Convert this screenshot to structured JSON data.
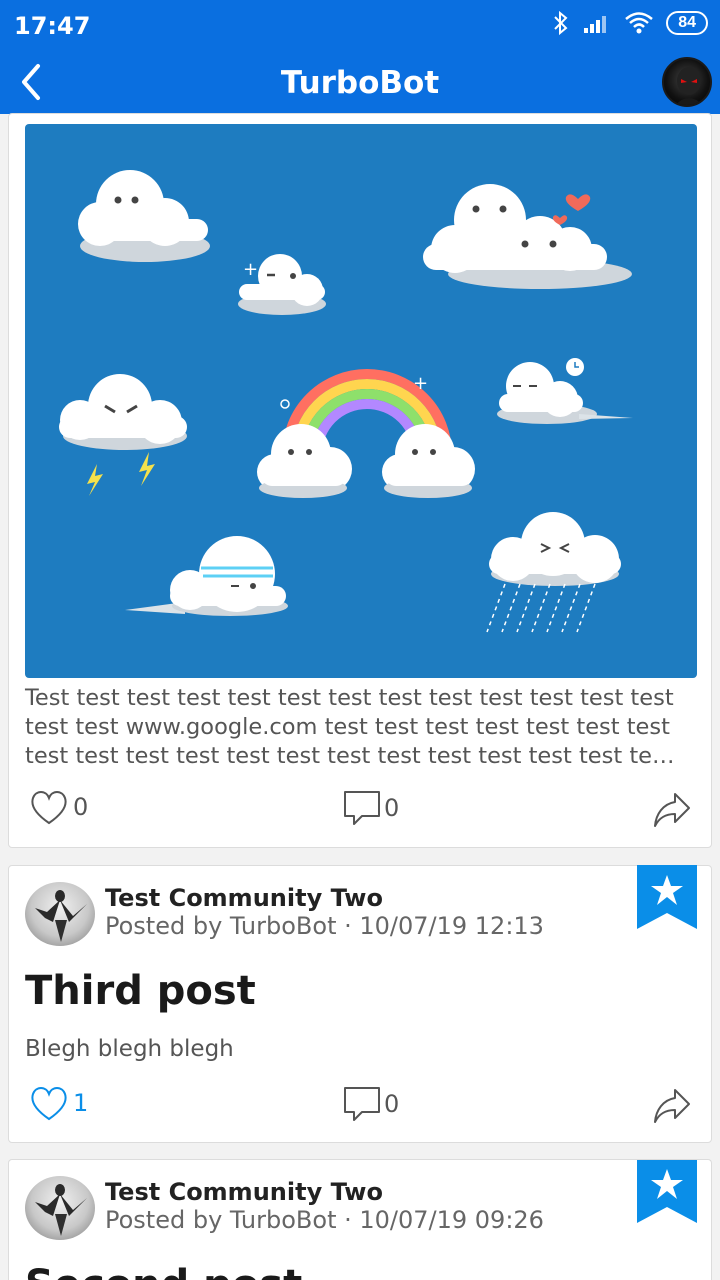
{
  "status": {
    "time": "17:47",
    "battery": "84"
  },
  "appbar": {
    "title": "TurboBot"
  },
  "posts": [
    {
      "text": "Test test test test test test test test test test test test test test test www.google.com test test test test test test test test test test test test test test test test test test test te…",
      "likes": "0",
      "comments": "0"
    },
    {
      "community": "Test Community Two",
      "byline": "Posted by TurboBot · 10/07/19 12:13",
      "title": "Third post",
      "body": "Blegh blegh blegh",
      "likes": "1",
      "comments": "0"
    },
    {
      "community": "Test Community Two",
      "byline": "Posted by TurboBot · 10/07/19 09:26",
      "title": "Second post"
    }
  ],
  "colors": {
    "primary": "#0a6fe0",
    "accent": "#0a8ee8",
    "image_bg": "#1e7cc0"
  },
  "icons": [
    "back-arrow-icon",
    "heart-icon",
    "comment-icon",
    "share-icon",
    "bookmark-star-icon",
    "bluetooth-icon",
    "signal-icon",
    "wifi-icon"
  ]
}
